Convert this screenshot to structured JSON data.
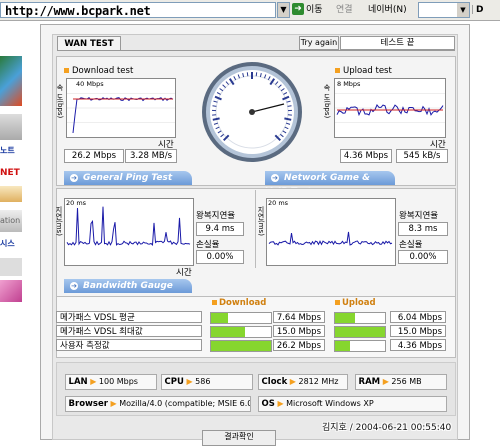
{
  "browser": {
    "address": "http://www.bcpark.net",
    "go_label": "이동",
    "links_label": "연결",
    "naver_label": "네이버(N)",
    "right_glyph": "D"
  },
  "sidebar": {
    "items": [
      "노트",
      "NET",
      "ation",
      "시스템"
    ]
  },
  "wan": {
    "tab_label": "WAN TEST",
    "try_again_label": "Try again",
    "status": "테스트 끝"
  },
  "download": {
    "title": "Download test",
    "ylabel": "속 도(bps)",
    "scale": "40 Mbps",
    "xlabel": "시간",
    "speed": "26.2 Mbps",
    "rate": "3.28 MB/s"
  },
  "upload": {
    "title": "Upload test",
    "ylabel": "속 도(bps)",
    "scale": "8 Mbps",
    "xlabel": "시간",
    "speed": "4.36 Mbps",
    "rate": "545 kB/s"
  },
  "tabs": {
    "ping": "General Ping Test",
    "game": "Network Game & VoIP Test",
    "gauge": "Bandwidth Gauge"
  },
  "ping": {
    "ylabel": "지연(ms)",
    "scale": "20 ms",
    "xlabel": "시간",
    "latency_label": "왕복지연율",
    "latency": "9.4 ms",
    "loss_label": "손실율",
    "loss": "0.00%"
  },
  "game": {
    "ylabel": "지연(ms)",
    "scale": "20 ms",
    "latency_label": "왕복지연율",
    "latency": "8.3 ms",
    "loss_label": "손실율",
    "loss": "0.00%"
  },
  "gauge": {
    "download_header": "Download",
    "upload_header": "Upload",
    "rows": [
      {
        "label": "메가패스 VDSL 평균",
        "down": "7.64 Mbps",
        "down_fill": 0.29,
        "up": "6.04 Mbps",
        "up_fill": 0.4
      },
      {
        "label": "메가패스 VDSL 최대값",
        "down": "15.0 Mbps",
        "down_fill": 0.57,
        "up": "15.0 Mbps",
        "up_fill": 1.0
      },
      {
        "label": "사용자 측정값",
        "down": "26.2 Mbps",
        "down_fill": 1.0,
        "up": "4.36 Mbps",
        "up_fill": 0.29
      }
    ]
  },
  "system": {
    "lan_label": "LAN",
    "lan": "100 Mbps",
    "cpu_label": "CPU",
    "cpu": "586",
    "clock_label": "Clock",
    "clock": "2812 MHz",
    "ram_label": "RAM",
    "ram": "256 MB",
    "browser_label": "Browser",
    "browser": "Mozilla/4.0 (compatible; MSIE 6.0",
    "os_label": "OS",
    "os": "Microsoft Windows XP"
  },
  "result_button": "결과확인",
  "watermark": "김지호 / 2004-06-21 00:55:40",
  "colors": {
    "accent_orange": "#f4a020",
    "tab_blue": "#6c9ad8",
    "bar_green": "#86d62e",
    "plot_line": "#1a1aa8",
    "plot_avg": "#d02020"
  }
}
